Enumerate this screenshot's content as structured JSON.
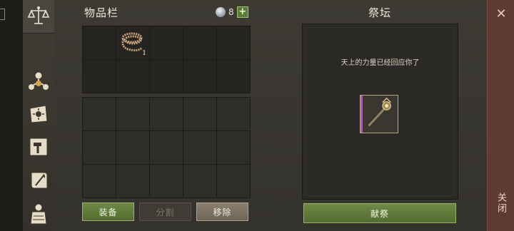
{
  "inventory": {
    "title": "物品栏",
    "gem_count": "8",
    "items": [
      {
        "slot": 1,
        "icon": "rope-coil-icon",
        "count": "1"
      }
    ],
    "buttons": {
      "equip": "装备",
      "split": "分割",
      "remove": "移除"
    }
  },
  "altar": {
    "title": "祭坛",
    "message": "天上的力量已经回应你了",
    "offered_item_icon": "scepter-icon",
    "offer_button": "献祭"
  },
  "close": {
    "label": "关闭"
  },
  "sidebar": {
    "icons": [
      "scales-icon",
      "organization-icon",
      "sun-scroll-icon",
      "hammer-map-icon",
      "quill-scroll-icon",
      "armor-icon"
    ]
  },
  "colors": {
    "accent_green": "#6e8a45",
    "rare_purple": "#b24fd1",
    "close_red": "#5e3a32"
  }
}
